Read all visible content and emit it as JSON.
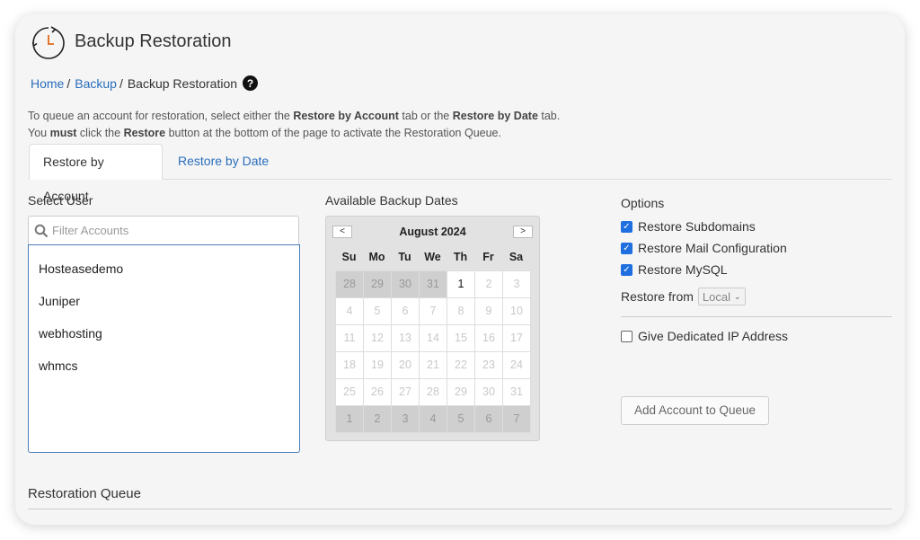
{
  "header": {
    "title": "Backup Restoration",
    "icon": "backup-clock-icon"
  },
  "breadcrumb": {
    "home": "Home",
    "backup": "Backup",
    "current": "Backup Restoration",
    "separator": "/",
    "help_glyph": "?"
  },
  "intro": {
    "line1_a": "To queue an account for restoration, select either the ",
    "line1_b": "Restore by Account",
    "line1_c": " tab or the ",
    "line1_d": "Restore by Date",
    "line1_e": " tab.",
    "line2_a": "You ",
    "line2_b": "must",
    "line2_c": " click the ",
    "line2_d": "Restore",
    "line2_e": " button at the bottom of the page to activate the Restoration Queue."
  },
  "tabs": {
    "by_account": "Restore by Account",
    "by_date": "Restore by Date"
  },
  "select_user": {
    "label": "Select User",
    "placeholder": "Filter Accounts",
    "accounts": [
      "Hosteasedemo",
      "Juniper",
      "webhosting",
      "whmcs"
    ]
  },
  "calendar": {
    "label": "Available Backup Dates",
    "month": "August 2024",
    "prev": "<",
    "next": ">",
    "weekdays": [
      "Su",
      "Mo",
      "Tu",
      "We",
      "Th",
      "Fr",
      "Sa"
    ],
    "days": [
      {
        "d": "28",
        "t": "other"
      },
      {
        "d": "29",
        "t": "other"
      },
      {
        "d": "30",
        "t": "other"
      },
      {
        "d": "31",
        "t": "other"
      },
      {
        "d": "1",
        "t": "available"
      },
      {
        "d": "2",
        "t": "day"
      },
      {
        "d": "3",
        "t": "day"
      },
      {
        "d": "4",
        "t": "day"
      },
      {
        "d": "5",
        "t": "day"
      },
      {
        "d": "6",
        "t": "day"
      },
      {
        "d": "7",
        "t": "day"
      },
      {
        "d": "8",
        "t": "day"
      },
      {
        "d": "9",
        "t": "day"
      },
      {
        "d": "10",
        "t": "day"
      },
      {
        "d": "11",
        "t": "day"
      },
      {
        "d": "12",
        "t": "day"
      },
      {
        "d": "13",
        "t": "day"
      },
      {
        "d": "14",
        "t": "day"
      },
      {
        "d": "15",
        "t": "day"
      },
      {
        "d": "16",
        "t": "day"
      },
      {
        "d": "17",
        "t": "day"
      },
      {
        "d": "18",
        "t": "day"
      },
      {
        "d": "19",
        "t": "day"
      },
      {
        "d": "20",
        "t": "day"
      },
      {
        "d": "21",
        "t": "day"
      },
      {
        "d": "22",
        "t": "day"
      },
      {
        "d": "23",
        "t": "day"
      },
      {
        "d": "24",
        "t": "day"
      },
      {
        "d": "25",
        "t": "day"
      },
      {
        "d": "26",
        "t": "day"
      },
      {
        "d": "27",
        "t": "day"
      },
      {
        "d": "28",
        "t": "day"
      },
      {
        "d": "29",
        "t": "day"
      },
      {
        "d": "30",
        "t": "day"
      },
      {
        "d": "31",
        "t": "day"
      },
      {
        "d": "1",
        "t": "other"
      },
      {
        "d": "2",
        "t": "other"
      },
      {
        "d": "3",
        "t": "other"
      },
      {
        "d": "4",
        "t": "other"
      },
      {
        "d": "5",
        "t": "other"
      },
      {
        "d": "6",
        "t": "other"
      },
      {
        "d": "7",
        "t": "other"
      }
    ]
  },
  "options": {
    "title": "Options",
    "restore_subdomains": "Restore Subdomains",
    "restore_mail": "Restore Mail Configuration",
    "restore_mysql": "Restore MySQL",
    "restore_from_label": "Restore from",
    "restore_from_value": "Local",
    "dedicated_ip": "Give Dedicated IP Address",
    "add_button": "Add Account to Queue"
  },
  "queue": {
    "title": "Restoration Queue"
  },
  "colors": {
    "link": "#2a6ebb",
    "checkbox": "#1f6fe0",
    "list_border": "#4d7bb8"
  }
}
